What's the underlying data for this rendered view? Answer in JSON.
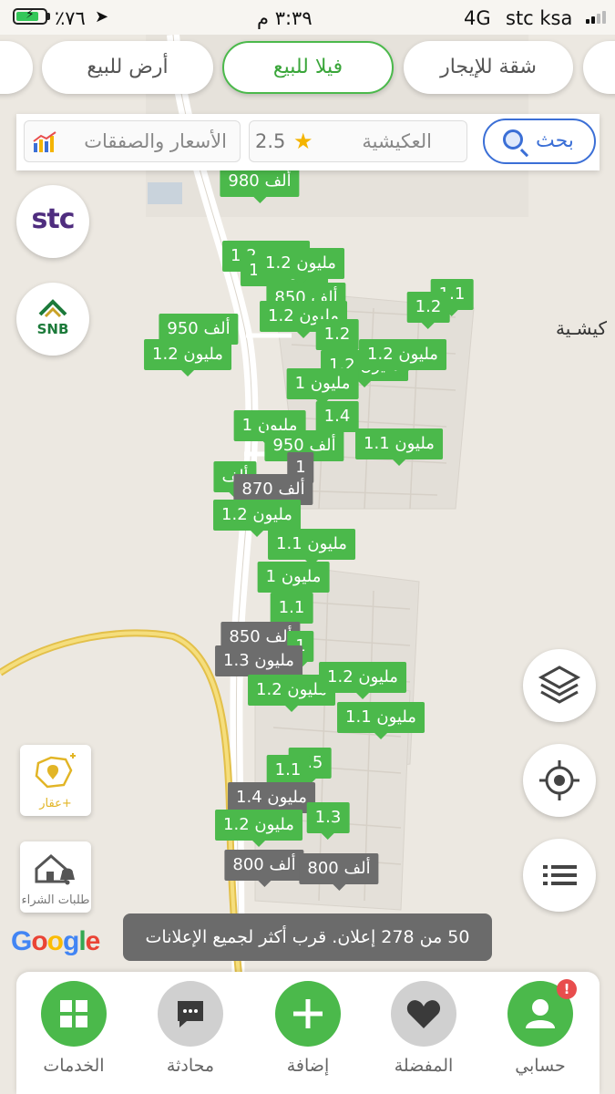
{
  "status_bar": {
    "battery": "٪٧٦",
    "time": "٣:٣٩ م",
    "network": "4G",
    "carrier": "stc ksa"
  },
  "tabs": [
    {
      "label": "شقة للإيجار"
    },
    {
      "label": "فيلا للبيع"
    },
    {
      "label": "أرض للبيع"
    }
  ],
  "search": {
    "button_label": "بحث",
    "location": "العكيشية",
    "rating": "2.5",
    "prices_label": "الأسعار والصفقات"
  },
  "map": {
    "area_label": "كيشـية",
    "listings": [
      {
        "price": "980 ألف",
        "style": "green"
      },
      {
        "price": "1.2 مليون",
        "style": "green"
      },
      {
        "price": "1.2 مليون",
        "style": "green"
      },
      {
        "price": "1.2 مليون",
        "style": "green"
      },
      {
        "price": "850 ألف",
        "style": "green"
      },
      {
        "price": "1.1",
        "style": "green"
      },
      {
        "price": "1.2",
        "style": "green"
      },
      {
        "price": "1.2 مليون",
        "style": "green"
      },
      {
        "price": "1.2",
        "style": "green"
      },
      {
        "price": "950 ألف",
        "style": "green"
      },
      {
        "price": "1.2 مليون",
        "style": "green"
      },
      {
        "price": "1.2 مليون",
        "style": "green"
      },
      {
        "price": "1.2 مليون",
        "style": "green"
      },
      {
        "price": "1 مليون",
        "style": "green"
      },
      {
        "price": "1.4",
        "style": "green"
      },
      {
        "price": "1 مليون",
        "style": "green"
      },
      {
        "price": "1.1 مليون",
        "style": "green"
      },
      {
        "price": "950 ألف",
        "style": "green"
      },
      {
        "price": "1",
        "style": "gray"
      },
      {
        "price": "ألف",
        "style": "green"
      },
      {
        "price": "870 ألف",
        "style": "gray"
      },
      {
        "price": "1.2 مليون",
        "style": "green"
      },
      {
        "price": "1.1 مليون",
        "style": "green"
      },
      {
        "price": "1 مليون",
        "style": "green"
      },
      {
        "price": "1.1",
        "style": "green"
      },
      {
        "price": "850 ألف",
        "style": "gray"
      },
      {
        "price": "1",
        "style": "green"
      },
      {
        "price": "1.3 مليون",
        "style": "gray"
      },
      {
        "price": "1.2 مليون",
        "style": "green"
      },
      {
        "price": "1.2 مليون",
        "style": "green"
      },
      {
        "price": "1.1 مليون",
        "style": "green"
      },
      {
        "price": "1.5",
        "style": "green"
      },
      {
        "price": "1.1",
        "style": "green"
      },
      {
        "price": "1.4 مليون",
        "style": "gray"
      },
      {
        "price": "1.3",
        "style": "green"
      },
      {
        "price": "1.2 مليون",
        "style": "green"
      },
      {
        "price": "800 ألف",
        "style": "gray"
      },
      {
        "price": "800 ألف",
        "style": "gray"
      }
    ]
  },
  "side_buttons": {
    "stc": "stc",
    "snb": "SNB",
    "add_property": "عقار+",
    "purchase_requests": "طلبات الشراء"
  },
  "google": "Google",
  "toast": "50 من 278 إعلان. قرب أكثر لجميع الإعلانات",
  "bottom_nav": [
    {
      "label": "حسابي",
      "icon": "user-icon",
      "badge": "!"
    },
    {
      "label": "المفضلة",
      "icon": "heart-icon"
    },
    {
      "label": "إضافة",
      "icon": "plus-icon"
    },
    {
      "label": "محادثة",
      "icon": "chat-icon"
    },
    {
      "label": "الخدمات",
      "icon": "grid-icon"
    }
  ],
  "colors": {
    "accent_green": "#4bb94b",
    "pin_gray": "#6d6d6d",
    "search_blue": "#3b6fd6"
  }
}
